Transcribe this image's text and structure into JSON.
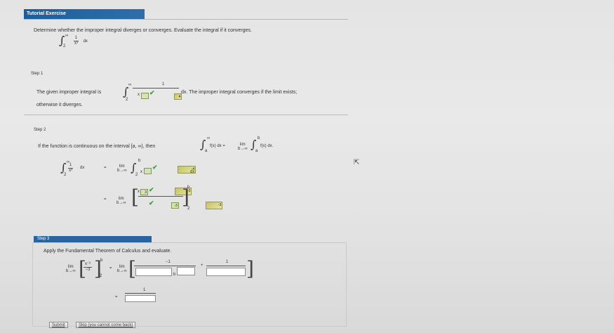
{
  "header": {
    "title": "Tutorial Exercise"
  },
  "prompt": {
    "text": "Determine whether the improper integral diverges or converges. Evaluate the integral if it converges.",
    "integral": {
      "upper": "∞",
      "lower": "2",
      "numerator": "1",
      "denominator": "x³",
      "dx": "dx"
    }
  },
  "step1": {
    "label": "Step 1",
    "text_before": "The given improper integral is",
    "upper": "∞",
    "lower": "2",
    "numerator": "1",
    "base_answer": "x",
    "exp_answer": "4",
    "text_after": "dx. The improper integral converges if the limit exists;",
    "text_line2": "otherwise it diverges."
  },
  "step2": {
    "label": "Step 2",
    "text_before": "If the function is continuous on the interval [a, ∞), then",
    "lhs": "f(x) dx =",
    "lim": "lim",
    "lim_sub": "b→∞",
    "rhs": "f(x) dx.",
    "row1": {
      "numerator": "1",
      "denominator": "x³",
      "dx": "dx",
      "equals": "=",
      "box_value": "-4",
      "exp_var": "x",
      "dx2": "dx"
    },
    "row2": {
      "equals": "=",
      "top_left": "3",
      "top_right": "-3",
      "bot_left": "-3",
      "bot_right": "-3",
      "upper": "b",
      "lower": "2",
      "x": "x"
    }
  },
  "step3": {
    "label": "Step 3",
    "instruction": "Apply the Fundamental Theorem of Calculus and evaluate.",
    "lim": "lim",
    "lim_sub": "b→∞",
    "frac_num": "x⁻²",
    "frac_den": "−3",
    "upper": "b",
    "lower": "2",
    "equals": "=",
    "minus_one": "−1",
    "plus": "+",
    "one": "1",
    "b_label": "b",
    "final_equals": "=",
    "final_num": "1"
  },
  "actions": {
    "submit": "Submit",
    "skip": "Skip (you cannot come back)"
  }
}
